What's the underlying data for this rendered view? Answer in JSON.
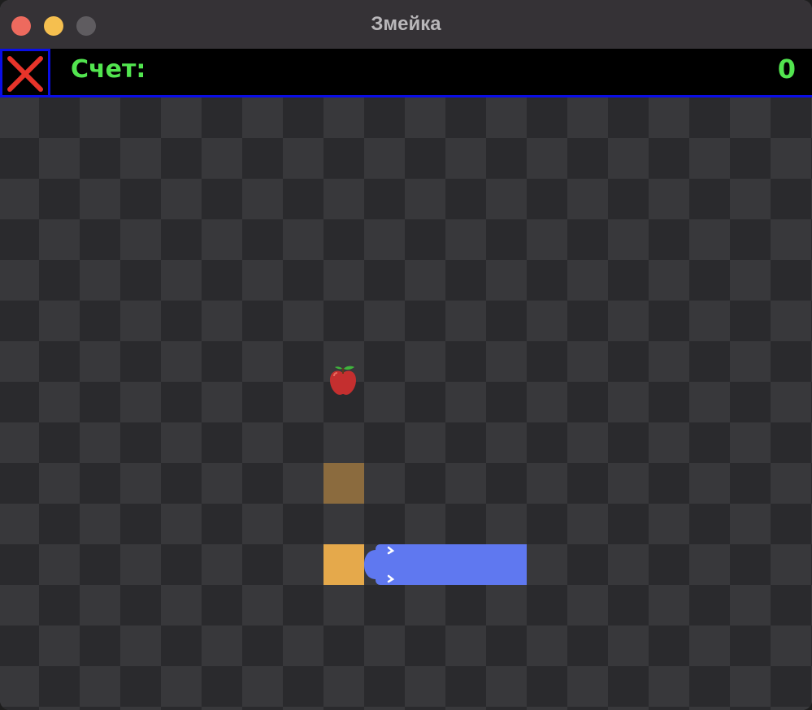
{
  "window": {
    "title": "Змейка"
  },
  "scorebar": {
    "label": "Счет:",
    "value": "0"
  },
  "icons": {
    "quit": "close-x-icon",
    "apple": "apple-icon"
  },
  "colors": {
    "score_text": "#52e54f",
    "border": "#0a0ee6",
    "snake_body": "#5f78f0",
    "snake_tail": "#e5a94b",
    "apple": "#c42f2f"
  }
}
